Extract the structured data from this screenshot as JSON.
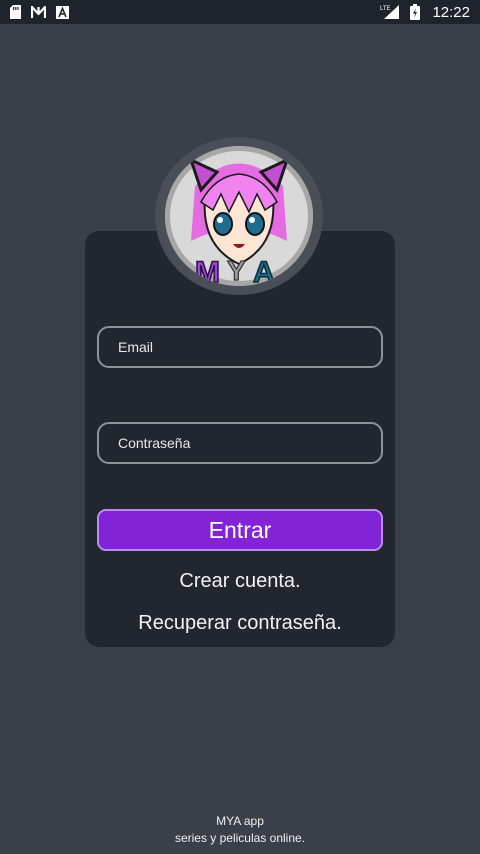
{
  "status_bar": {
    "icons_left": [
      "sd-card-icon",
      "n-app-icon",
      "font-app-icon"
    ],
    "network_label": "LTE",
    "time": "12:22"
  },
  "login": {
    "email_placeholder": "Email",
    "password_placeholder": "Contraseña",
    "enter_label": "Entrar",
    "create_account_label": "Crear cuenta.",
    "recover_password_label": "Recuperar contraseña."
  },
  "logo": {
    "text": "MYA"
  },
  "footer": {
    "title": "MYA app",
    "subtitle": "series y peliculas online."
  },
  "colors": {
    "background": "#3b3f49",
    "card": "#22262f",
    "accent": "#8323d8",
    "status_bar": "#1f232b"
  }
}
